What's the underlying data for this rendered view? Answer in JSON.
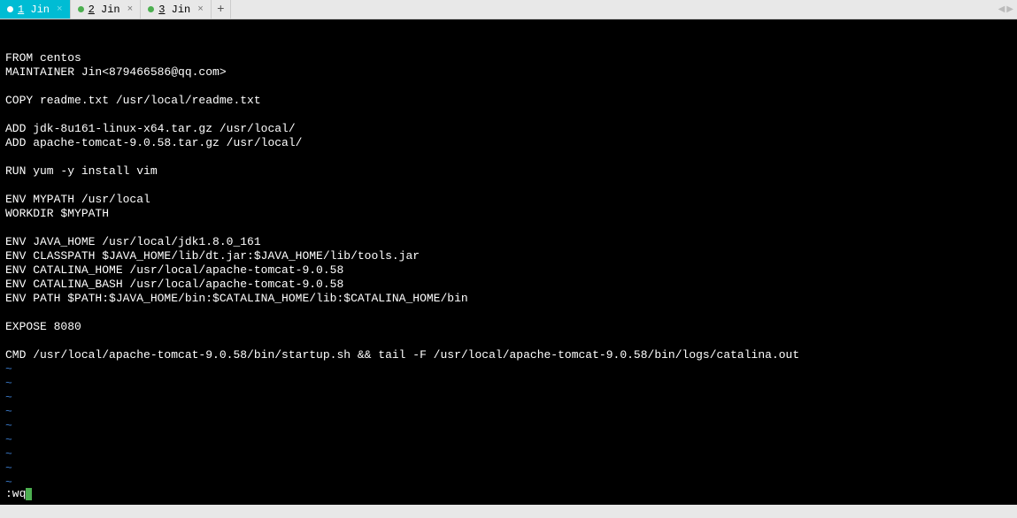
{
  "tabs": [
    {
      "index": "1",
      "label": "Jin",
      "active": true
    },
    {
      "index": "2",
      "label": "Jin",
      "active": false
    },
    {
      "index": "3",
      "label": "Jin",
      "active": false
    }
  ],
  "add_tab_label": "+",
  "nav": {
    "left": "◀",
    "right": "▶"
  },
  "close_label": "×",
  "code_lines": [
    "FROM centos",
    "MAINTAINER Jin<879466586@qq.com>",
    "",
    "COPY readme.txt /usr/local/readme.txt",
    "",
    "ADD jdk-8u161-linux-x64.tar.gz /usr/local/",
    "ADD apache-tomcat-9.0.58.tar.gz /usr/local/",
    "",
    "RUN yum -y install vim",
    "",
    "ENV MYPATH /usr/local",
    "WORKDIR $MYPATH",
    "",
    "ENV JAVA_HOME /usr/local/jdk1.8.0_161",
    "ENV CLASSPATH $JAVA_HOME/lib/dt.jar:$JAVA_HOME/lib/tools.jar",
    "ENV CATALINA_HOME /usr/local/apache-tomcat-9.0.58",
    "ENV CATALINA_BASH /usr/local/apache-tomcat-9.0.58",
    "ENV PATH $PATH:$JAVA_HOME/bin:$CATALINA_HOME/lib:$CATALINA_HOME/bin",
    "",
    "EXPOSE 8080",
    "",
    "CMD /usr/local/apache-tomcat-9.0.58/bin/startup.sh && tail -F /usr/local/apache-tomcat-9.0.58/bin/logs/catalina.out"
  ],
  "tilde_count": 9,
  "tilde_char": "~",
  "vim_command": ":wq"
}
